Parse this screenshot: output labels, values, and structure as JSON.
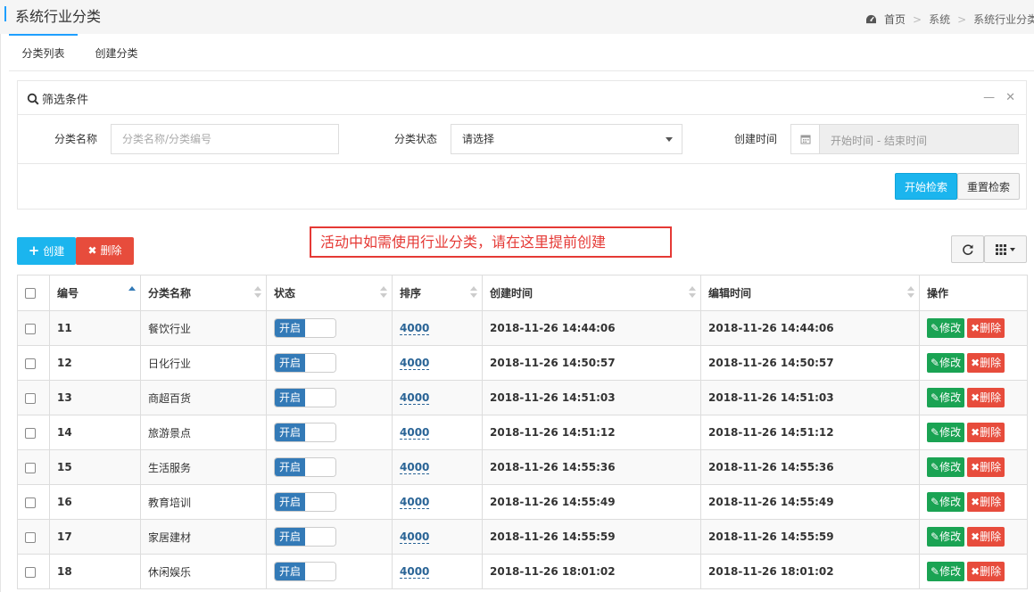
{
  "header": {
    "title": "系统行业分类",
    "breadcrumb": [
      "首页",
      "系统",
      "系统行业分类"
    ]
  },
  "tabs": [
    {
      "label": "分类列表",
      "active": true
    },
    {
      "label": "创建分类",
      "active": false
    }
  ],
  "filter": {
    "title": "筛选条件",
    "name_label": "分类名称",
    "name_placeholder": "分类名称/分类编号",
    "status_label": "分类状态",
    "status_value": "请选择",
    "time_label": "创建时间",
    "time_placeholder": "开始时间 - 结束时间",
    "search_button": "开始检索",
    "reset_button": "重置检索"
  },
  "toolbar": {
    "create_label": "创建",
    "delete_label": "删除",
    "notice": "活动中如需使用行业分类，请在这里提前创建"
  },
  "table": {
    "columns": [
      "编号",
      "分类名称",
      "状态",
      "排序",
      "创建时间",
      "编辑时间",
      "操作"
    ],
    "switch_on_label": "开启",
    "edit_label": "修改",
    "delete_label": "删除",
    "rows": [
      {
        "id": "11",
        "name": "餐饮行业",
        "sort": "4000",
        "created": "2018-11-26 14:44:06",
        "edited": "2018-11-26 14:44:06"
      },
      {
        "id": "12",
        "name": "日化行业",
        "sort": "4000",
        "created": "2018-11-26 14:50:57",
        "edited": "2018-11-26 14:50:57"
      },
      {
        "id": "13",
        "name": "商超百货",
        "sort": "4000",
        "created": "2018-11-26 14:51:03",
        "edited": "2018-11-26 14:51:03"
      },
      {
        "id": "14",
        "name": "旅游景点",
        "sort": "4000",
        "created": "2018-11-26 14:51:12",
        "edited": "2018-11-26 14:51:12"
      },
      {
        "id": "15",
        "name": "生活服务",
        "sort": "4000",
        "created": "2018-11-26 14:55:36",
        "edited": "2018-11-26 14:55:36"
      },
      {
        "id": "16",
        "name": "教育培训",
        "sort": "4000",
        "created": "2018-11-26 14:55:49",
        "edited": "2018-11-26 14:55:49"
      },
      {
        "id": "17",
        "name": "家居建材",
        "sort": "4000",
        "created": "2018-11-26 14:55:59",
        "edited": "2018-11-26 14:55:59"
      },
      {
        "id": "18",
        "name": "休闲娱乐",
        "sort": "4000",
        "created": "2018-11-26 18:01:02",
        "edited": "2018-11-26 18:01:02"
      }
    ]
  },
  "colors": {
    "primary": "#1bb5ee",
    "danger": "#e74c3c",
    "success": "#1aa353",
    "switch_on": "#337ab7",
    "link": "#2a6496"
  }
}
